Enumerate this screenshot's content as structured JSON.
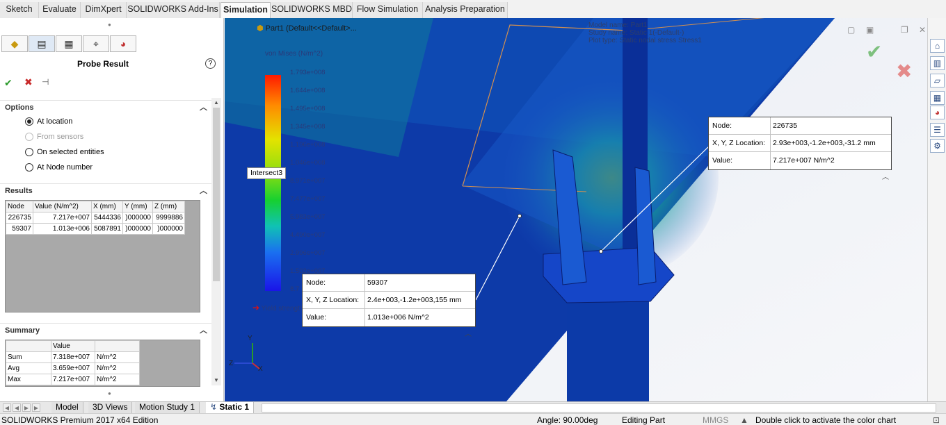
{
  "command_tabs": [
    {
      "label": "Sketch",
      "active": false
    },
    {
      "label": "Evaluate",
      "active": false
    },
    {
      "label": "DimXpert",
      "active": false
    },
    {
      "label": "SOLIDWORKS Add-Ins",
      "active": false
    },
    {
      "label": "Simulation",
      "active": true
    },
    {
      "label": "SOLIDWORKS MBD",
      "active": false
    },
    {
      "label": "Flow Simulation",
      "active": false
    },
    {
      "label": "Analysis Preparation",
      "active": false
    }
  ],
  "property_manager": {
    "icons": [
      "feature-manager-icon",
      "property-manager-icon",
      "configuration-manager-icon",
      "dimxpert-manager-icon",
      "display-manager-icon"
    ],
    "title": "Probe Result",
    "help": "?",
    "options": {
      "header": "Options",
      "choices": [
        {
          "label": "At location",
          "selected": true,
          "enabled": true
        },
        {
          "label": "From sensors",
          "selected": false,
          "enabled": false
        },
        {
          "label": "On selected entities",
          "selected": false,
          "enabled": true
        },
        {
          "label": "At Node number",
          "selected": false,
          "enabled": true
        }
      ]
    },
    "results": {
      "header": "Results",
      "columns": [
        "Node",
        "Value (N/m^2)",
        "X (mm)",
        "Y (mm)",
        "Z (mm)"
      ],
      "rows": [
        [
          "226735",
          "7.217e+007",
          "5444336",
          ")000000",
          "9999886"
        ],
        [
          "59307",
          "1.013e+006",
          "5087891",
          ")000000",
          ")000000"
        ]
      ]
    },
    "summary": {
      "header": "Summary",
      "columns": [
        "",
        "Value",
        ""
      ],
      "rows": [
        [
          "Sum",
          "7.318e+007",
          "N/m^2"
        ],
        [
          "Avg",
          "3.659e+007",
          "N/m^2"
        ],
        [
          "Max",
          "7.217e+007",
          "N/m^2"
        ]
      ]
    }
  },
  "viewport": {
    "tree_label": "Part1  (Default<<Default>...",
    "study_info": [
      "Model name: Part1",
      "Study name: Static 1(-Default-)",
      "Plot type: Static nodal stress Stress1"
    ],
    "legend": {
      "title": "von Mises (N/m^2)",
      "ticks": [
        "1.793e+008",
        "1.644e+008",
        "1.495e+008",
        "1.345e+008",
        "1.196e+008",
        "1.046e+008",
        "8.971e+007",
        "7.477e+007",
        "5.983e+007",
        "4.490e+007",
        "2.996e+007",
        "1.502e+007",
        "8.7"
      ],
      "yield_label": "Yield strength"
    },
    "intersect_tag": "Intersect3",
    "probe_a": {
      "node_label": "Node:",
      "node": "226735",
      "loc_label": "X, Y, Z Location:",
      "loc": "2.93e+003,-1.2e+003,-31.2 mm",
      "value_label": "Value:",
      "value": "7.217e+007 N/m^2"
    },
    "probe_b": {
      "node_label": "Node:",
      "node": "59307",
      "loc_label": "X, Y, Z Location:",
      "loc": "2.4e+003,-1.2e+003,155 mm",
      "value_label": "Value:",
      "value": "1.013e+006 N/m^2"
    },
    "triad": {
      "y": "Y",
      "z": "Z",
      "x": "X"
    },
    "window_controls": [
      "▢",
      "▣",
      "❐",
      "✕"
    ]
  },
  "task_pane": [
    "home-icon",
    "parts-icon",
    "folder-icon",
    "view-palette-icon",
    "appearance-icon",
    "custom-properties-icon",
    "simulation-advisor-icon"
  ],
  "bottom_tabs": [
    {
      "label": "Model",
      "active": false
    },
    {
      "label": "3D Views",
      "active": false
    },
    {
      "label": "Motion Study 1",
      "active": false
    },
    {
      "label": "Static 1",
      "active": true
    }
  ],
  "status_bar": {
    "edition": "SOLIDWORKS Premium 2017 x64 Edition",
    "angle": "Angle: 90.00deg",
    "mode": "Editing Part",
    "units": "MMGS",
    "hint": "Double click to activate the color chart"
  }
}
